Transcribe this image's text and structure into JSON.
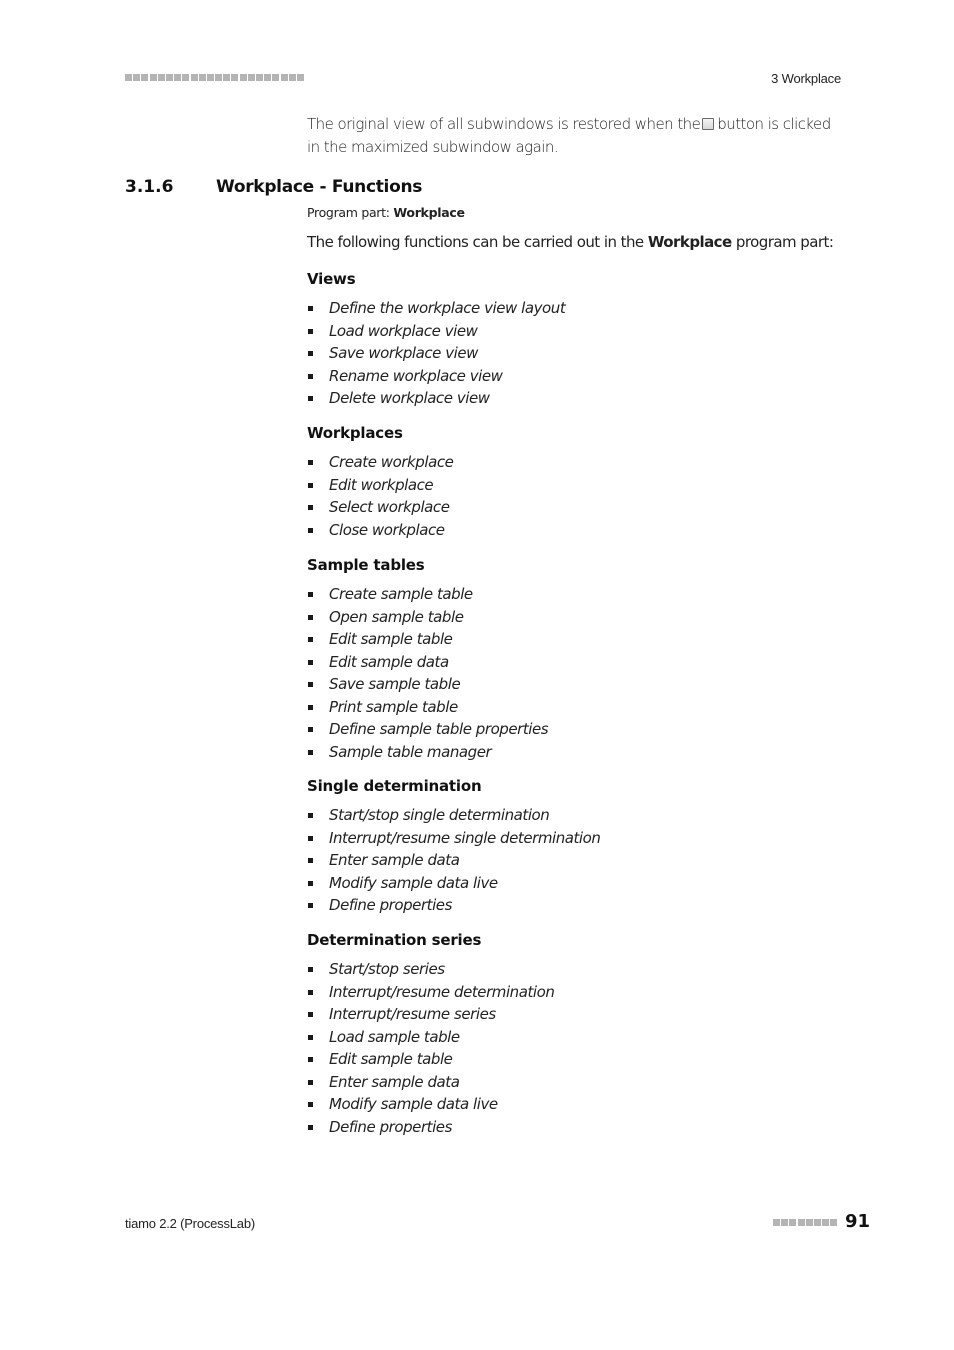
{
  "header": {
    "decor_square_count": 22,
    "chapter": "3 Workplace"
  },
  "intro": {
    "text_before": "The original view of all subwindows is restored when the",
    "icon": "restore-window-icon",
    "text_after": "button is clicked in the maximized subwindow again."
  },
  "section": {
    "number": "3.1.6",
    "title": "Workplace - Functions",
    "program_part_label": "Program part:",
    "program_part_value": "Workplace",
    "lead_before": "The following functions can be carried out in the",
    "lead_bold": "Workplace",
    "lead_after": "program part:"
  },
  "groups": [
    {
      "title": "Views",
      "items": [
        "Define the workplace view layout",
        "Load workplace view",
        "Save workplace view",
        "Rename workplace view",
        "Delete workplace view"
      ]
    },
    {
      "title": "Workplaces",
      "items": [
        "Create workplace",
        "Edit workplace",
        "Select workplace",
        "Close workplace"
      ]
    },
    {
      "title": "Sample tables",
      "items": [
        "Create sample table",
        "Open sample table",
        "Edit sample table",
        "Edit sample data",
        "Save sample table",
        "Print sample table",
        "Define sample table properties",
        "Sample table manager"
      ]
    },
    {
      "title": "Single determination",
      "items": [
        "Start/stop single determination",
        "Interrupt/resume single determination",
        "Enter sample data",
        "Modify sample data live",
        "Define properties"
      ]
    },
    {
      "title": "Determination series",
      "items": [
        "Start/stop series",
        "Interrupt/resume determination",
        "Interrupt/resume series",
        "Load sample table",
        "Edit sample table",
        "Enter sample data",
        "Modify sample data live",
        "Define properties"
      ]
    }
  ],
  "footer": {
    "product": "tiamo 2.2 (ProcessLab)",
    "decor_square_count": 8,
    "page_number": "91"
  }
}
